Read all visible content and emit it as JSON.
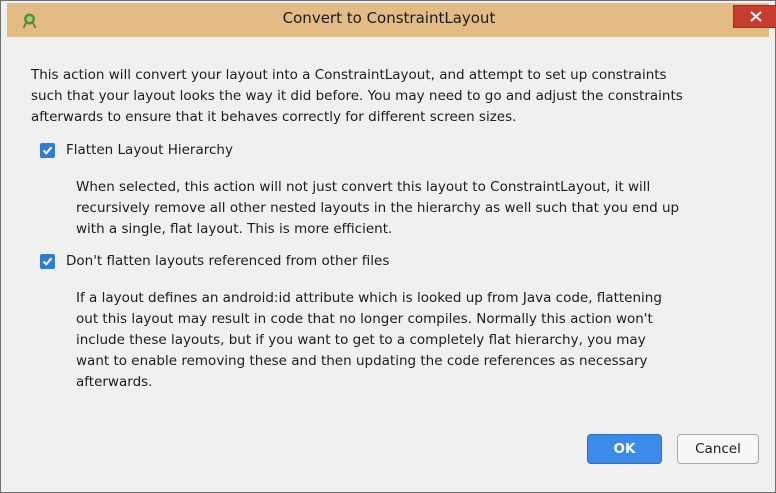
{
  "dialog": {
    "title": "Convert to ConstraintLayout",
    "description": [
      "This action will convert your layout into a ConstraintLayout, and attempt to set up constraints",
      "such that your layout looks the way it did before. You may need to go and adjust the constraints",
      "afterwards to ensure that it behaves correctly for different screen sizes."
    ],
    "options": [
      {
        "label": "Flatten Layout Hierarchy",
        "checked": true,
        "help": [
          "When selected, this action will not just convert this layout to ConstraintLayout, it will",
          "recursively remove all other nested layouts in the hierarchy as well such that you end up",
          "with a single, flat layout. This is more efficient."
        ]
      },
      {
        "label": "Don't flatten layouts referenced from other files",
        "checked": true,
        "help": [
          "If a layout defines an android:id attribute which is looked up from Java code, flattening",
          "out this layout may result in code that no longer compiles. Normally this action won't",
          "include these layouts, but if you want to get to a completely flat hierarchy, you may",
          "want to enable removing these and then updating the code references as necessary",
          "afterwards."
        ]
      }
    ],
    "buttons": {
      "ok": "OK",
      "cancel": "Cancel"
    }
  },
  "colors": {
    "titlebar": "#e3bb84",
    "close_button": "#c73c2e",
    "checkbox": "#2e7bd8",
    "ok_button": "#3c8be8",
    "background": "#f0f0f0"
  },
  "icons": {
    "app": "android-studio-icon",
    "close": "close-icon",
    "checkmark": "checkmark-icon"
  }
}
